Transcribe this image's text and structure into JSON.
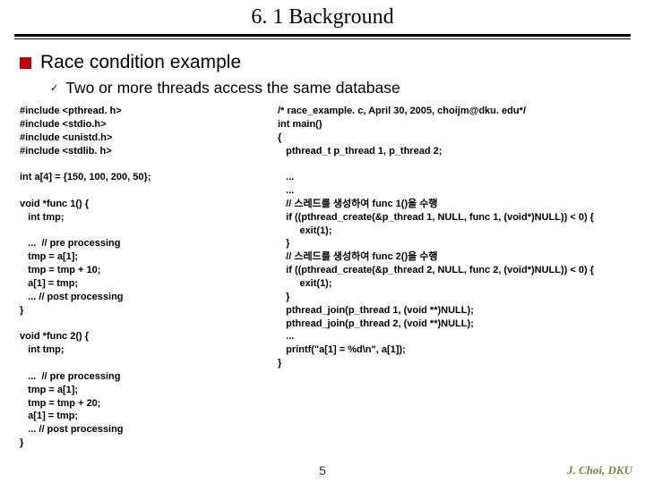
{
  "title": "6. 1 Background",
  "heading": "Race condition example",
  "subheading": "Two or more threads access the same database",
  "code_left": "#include <pthread. h>\n#include <stdio.h>\n#include <unistd.h>\n#include <stdlib. h>\n\nint a[4] = {150, 100, 200, 50};\n\nvoid *func 1() {\n   int tmp;\n\n   ...  // pre processing\n   tmp = a[1];\n   tmp = tmp + 10;\n   a[1] = tmp;\n   ... // post processing\n}\n\nvoid *func 2() {\n   int tmp;\n\n   ...  // pre processing\n   tmp = a[1];\n   tmp = tmp + 20;\n   a[1] = tmp;\n   ... // post processing\n}",
  "code_right": "/* race_example. c, April 30, 2005, choijm@dku. edu*/\nint main()\n{\n   pthread_t p_thread 1, p_thread 2;\n\n   ...\n   ...\n   // 스레드를 생성하여 func 1()을 수행\n   if ((pthread_create(&p_thread 1, NULL, func 1, (void*)NULL)) < 0) {\n        exit(1);\n   }\n   // 스레드를 생성하여 func 2()을 수행\n   if ((pthread_create(&p_thread 2, NULL, func 2, (void*)NULL)) < 0) {\n        exit(1);\n   }\n   pthread_join(p_thread 1, (void **)NULL);\n   pthread_join(p_thread 2, (void **)NULL);\n   ...\n   printf(\"a[1] = %d\\n\", a[1]);\n}",
  "page_number": "5",
  "footer": "J. Choi, DKU"
}
